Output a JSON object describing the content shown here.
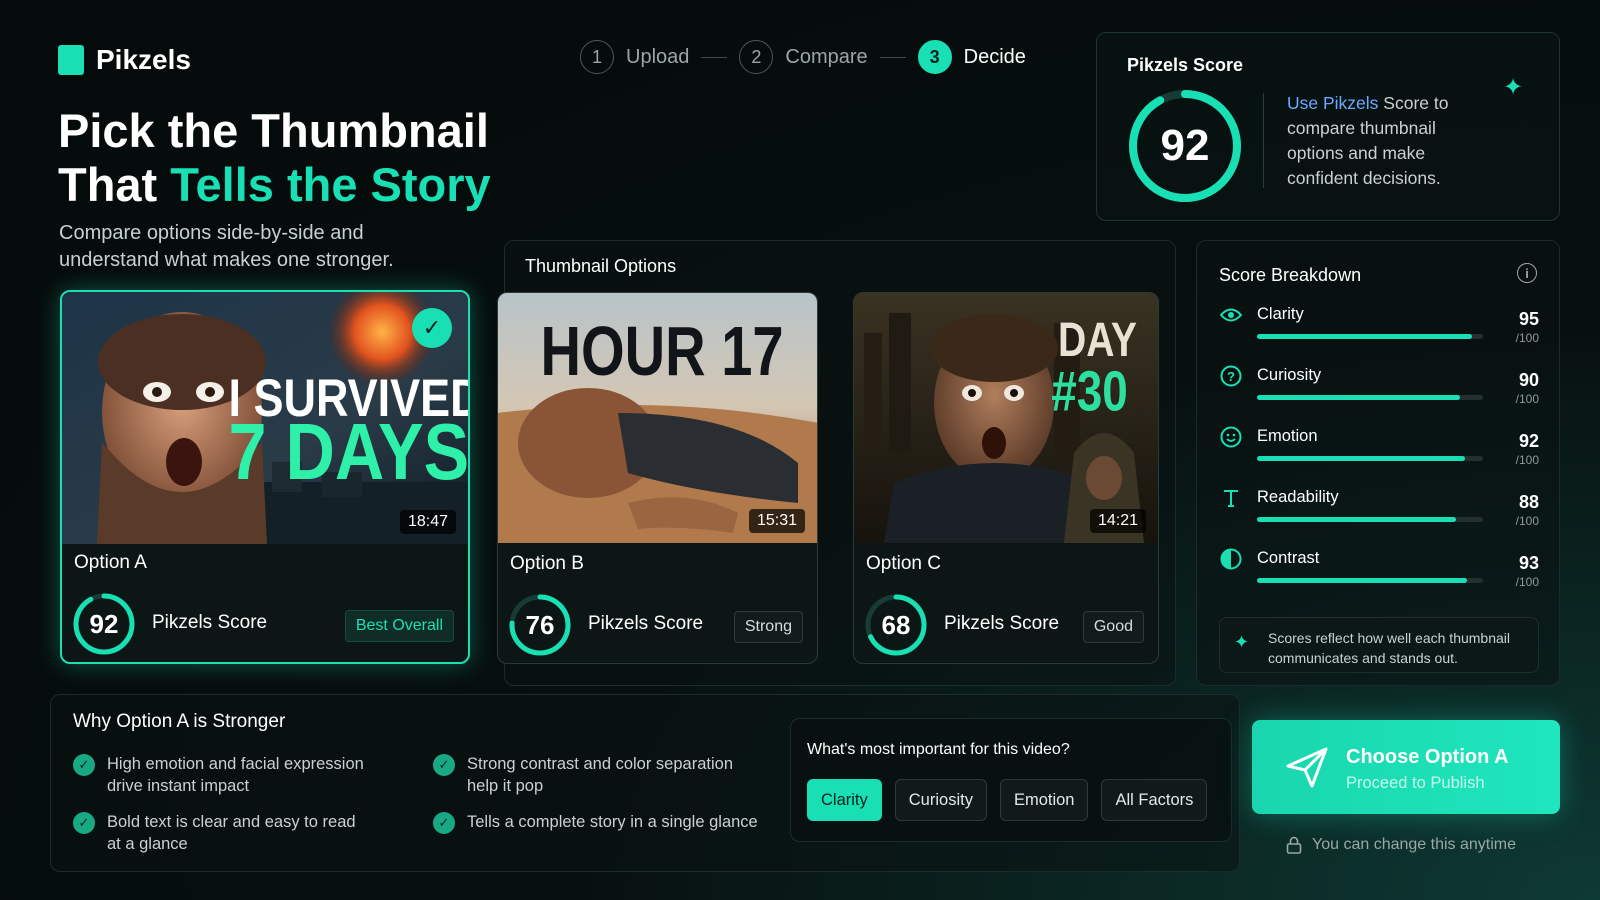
{
  "brand": {
    "name": "Pikzels"
  },
  "hero": {
    "title_line1": "Pick the Thumbnail",
    "title_line2_prefix": "That ",
    "title_line2_accent": "Tells the Story",
    "subtitle": "Compare options side-by-side and understand what makes one stronger."
  },
  "steps": [
    {
      "num": "1",
      "label": "Upload",
      "active": false
    },
    {
      "num": "2",
      "label": "Compare",
      "active": false
    },
    {
      "num": "3",
      "label": "Decide",
      "active": true
    }
  ],
  "score_card": {
    "title": "Pikzels Score",
    "value": "92",
    "value_fraction": 0.92,
    "desc_link": "Use Pikzels",
    "desc_rest": " Score to compare thumbnail options and make confident decisions."
  },
  "options_panel": {
    "title": "Thumbnail Options"
  },
  "options": [
    {
      "name": "Option A",
      "duration": "18:47",
      "score": "92",
      "score_fraction": 0.92,
      "score_label": "Pikzels Score",
      "tag": "Best Overall",
      "selected": true,
      "thumb_line1": "I SURVIVED",
      "thumb_line2": "7 DAYS"
    },
    {
      "name": "Option B",
      "duration": "15:31",
      "score": "76",
      "score_fraction": 0.76,
      "score_label": "Pikzels Score",
      "tag": "Strong",
      "selected": false,
      "thumb_line1": "HOUR 17"
    },
    {
      "name": "Option C",
      "duration": "14:21",
      "score": "68",
      "score_fraction": 0.68,
      "score_label": "Pikzels Score",
      "tag": "Good",
      "selected": false,
      "thumb_line1": "DAY",
      "thumb_line2": "#30"
    }
  ],
  "breakdown": {
    "title": "Score Breakdown",
    "max_label": "/100",
    "rows": [
      {
        "label": "Clarity",
        "value": "95",
        "fraction": 0.95,
        "icon": "eye-icon"
      },
      {
        "label": "Curiosity",
        "value": "90",
        "fraction": 0.9,
        "icon": "question-icon"
      },
      {
        "label": "Emotion",
        "value": "92",
        "fraction": 0.92,
        "icon": "smile-icon"
      },
      {
        "label": "Readability",
        "value": "88",
        "fraction": 0.88,
        "icon": "text-icon"
      },
      {
        "label": "Contrast",
        "value": "93",
        "fraction": 0.93,
        "icon": "contrast-icon"
      }
    ],
    "note": "Scores reflect how well each thumbnail communicates and stands out."
  },
  "why": {
    "title": "Why Option A is Stronger",
    "items": [
      "High emotion and facial expression drive instant impact",
      "Strong contrast and color separation help it pop",
      "Bold text is clear and easy to read at a glance",
      "Tells a complete story in a single glance"
    ]
  },
  "priority": {
    "question": "What's most important for this video?",
    "chips": [
      "Clarity",
      "Curiosity",
      "Emotion",
      "All Factors"
    ],
    "active_index": 0
  },
  "cta": {
    "title": "Choose Option A",
    "subtitle": "Proceed to Publish",
    "change_note": "You can change this anytime"
  },
  "colors": {
    "accent": "#19e0b4",
    "link": "#6ca8ff",
    "background": "#050a0a"
  }
}
